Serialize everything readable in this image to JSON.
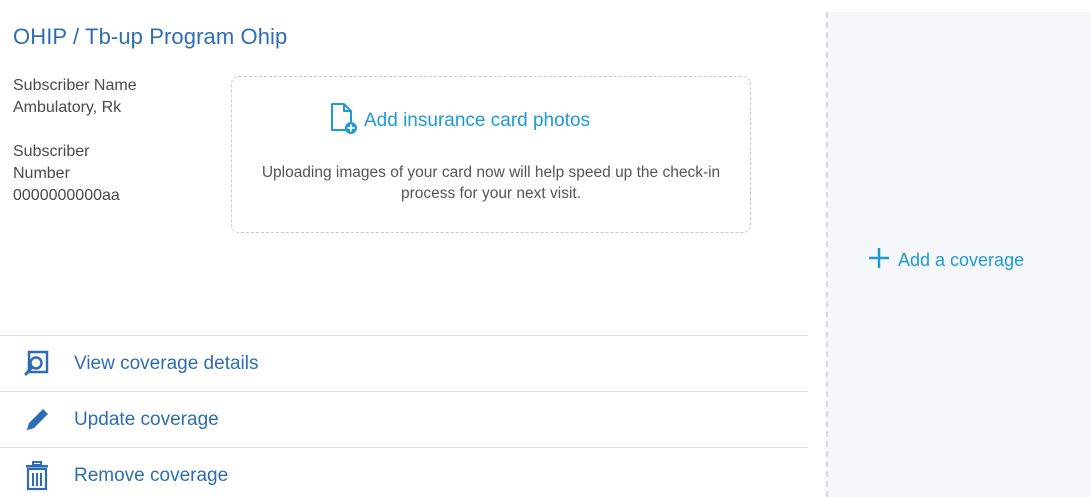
{
  "coverage": {
    "title": "OHIP / Tb-up Program Ohip",
    "subscriber_name_label": "Subscriber Name",
    "subscriber_name_value": "Ambulatory, Rk",
    "subscriber_number_label": "Subscriber Number",
    "subscriber_number_value": "0000000000aa"
  },
  "upload": {
    "link_label": "Add insurance card photos",
    "description": "Uploading images of your card now will help speed up the check-in process for your next visit."
  },
  "actions": [
    {
      "label": "View coverage details",
      "icon": "magnify-document-icon"
    },
    {
      "label": "Update coverage",
      "icon": "pencil-icon"
    },
    {
      "label": "Remove coverage",
      "icon": "trash-icon"
    }
  ],
  "right_panel": {
    "add_label": "Add a coverage",
    "icon": "plus-icon"
  },
  "colors": {
    "title_blue": "#2f6db3",
    "link_blue": "#1e9ad6",
    "panel_bg": "#f6f7fb"
  }
}
